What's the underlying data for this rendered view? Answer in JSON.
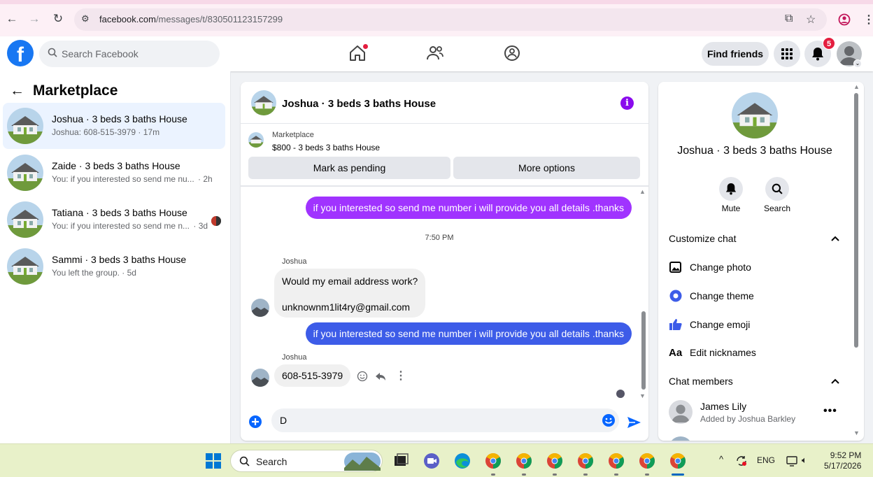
{
  "browser": {
    "url_host": "facebook.com",
    "url_path": "/messages/t/830501123157299"
  },
  "facebook": {
    "search_placeholder": "Search Facebook",
    "find_friends": "Find friends",
    "notif_count": "5",
    "brand_color": "#1877f2"
  },
  "left": {
    "title": "Marketplace",
    "conversations": [
      {
        "name": "Joshua · 3 beds 3 baths House",
        "preview": "Joshua: 608-515-3979 · 17m",
        "active": true
      },
      {
        "name": "Zaide · 3 beds 3 baths House",
        "preview": "You: if you interested so send me nu...",
        "time": "· 2h"
      },
      {
        "name": "Tatiana · 3 beds 3 baths House",
        "preview": "You: if you interested so send me n...",
        "time": "· 3d"
      },
      {
        "name": "Sammi · 3 beds 3 baths House",
        "preview": "You left the group. · 5d"
      }
    ]
  },
  "chat": {
    "title": "Joshua · 3 beds 3 baths House",
    "listing_label": "Marketplace",
    "listing_detail": "$800 - 3 beds 3 baths House",
    "mark_pending": "Mark as pending",
    "more_options": "More options",
    "messages": {
      "out1": "if you interested so send me number i will provide you all details .thanks",
      "timestamp": "7:50 PM",
      "sender1": "Joshua",
      "in1_line1": "Would my email address work?",
      "in1_line2": "unknownm1lit4ry@gmail.com",
      "out2": "if you interested so send me number i will provide you all details .thanks",
      "sender2": "Joshua",
      "in2": "608-515-3979"
    },
    "composer_value": "D",
    "out1_color": "#a033ff",
    "out2_color": "#3d5ce8"
  },
  "right": {
    "name": "Joshua · 3 beds 3 baths House",
    "mute": "Mute",
    "search": "Search",
    "customize": "Customize chat",
    "change_photo": "Change photo",
    "change_theme": "Change theme",
    "change_emoji": "Change emoji",
    "edit_nicknames": "Edit nicknames",
    "chat_members": "Chat members",
    "member_name": "James Lily",
    "member_sub": "Added by Joshua Barkley"
  },
  "taskbar": {
    "search": "Search",
    "lang": "ENG",
    "time": "9:52 PM",
    "date": "5/17/2026"
  }
}
